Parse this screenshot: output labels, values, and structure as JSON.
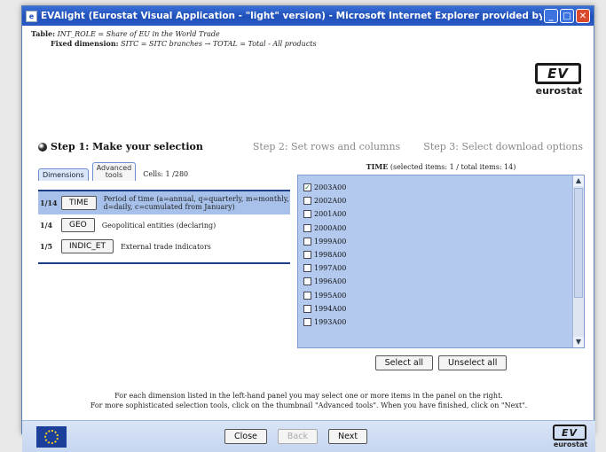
{
  "window": {
    "title": "EVAlight (Eurostat Visual Application - \"light\" version) - Microsoft Internet Explorer provided by European Co...",
    "minimize": "_",
    "maximize": "□",
    "close": "✕"
  },
  "table_info": {
    "table_label": "Table:",
    "table_value": "INT_ROLE = Share of EU in the World Trade",
    "fixed_label": "Fixed dimension:",
    "fixed_value": "SITC = SITC branches → TOTAL = Total - All products"
  },
  "logo": {
    "mark": "EV",
    "word": "eurostat"
  },
  "steps": {
    "step1": "Step 1: Make your selection",
    "step2": "Step 2: Set rows and columns",
    "step3": "Step 3: Select download options"
  },
  "tabs": {
    "dimensions": "Dimensions",
    "advanced_line1": "Advanced",
    "advanced_line2": "tools"
  },
  "cells": "Cells: 1 /280",
  "dimensions": [
    {
      "count": "1/14",
      "button": "TIME",
      "desc": "Period of time (a=annual, q=quarterly, m=monthly, d=daily, c=cumulated from January)"
    },
    {
      "count": "1/4",
      "button": "GEO",
      "desc": "Geopolitical entities (declaring)"
    },
    {
      "count": "1/5",
      "button": "INDIC_ET",
      "desc": "External trade indicators"
    }
  ],
  "time_panel": {
    "header_name": "TIME",
    "header_info": "(selected items: 1 / total items: 14)",
    "items": [
      {
        "label": "2003A00",
        "checked": true
      },
      {
        "label": "2002A00",
        "checked": false
      },
      {
        "label": "2001A00",
        "checked": false
      },
      {
        "label": "2000A00",
        "checked": false
      },
      {
        "label": "1999A00",
        "checked": false
      },
      {
        "label": "1998A00",
        "checked": false
      },
      {
        "label": "1997A00",
        "checked": false
      },
      {
        "label": "1996A00",
        "checked": false
      },
      {
        "label": "1995A00",
        "checked": false
      },
      {
        "label": "1994A00",
        "checked": false
      },
      {
        "label": "1993A00",
        "checked": false
      }
    ],
    "select_all": "Select all",
    "unselect_all": "Unselect all"
  },
  "help": {
    "line1": "For each dimension listed in the left-hand panel you may select one or more items in the panel on the right.",
    "line2": "For more sophisticated selection tools, click on the thumbnail \"Advanced tools\". When you have finished, click on \"Next\"."
  },
  "footer": {
    "close": "Close",
    "back": "Back",
    "next": "Next"
  }
}
